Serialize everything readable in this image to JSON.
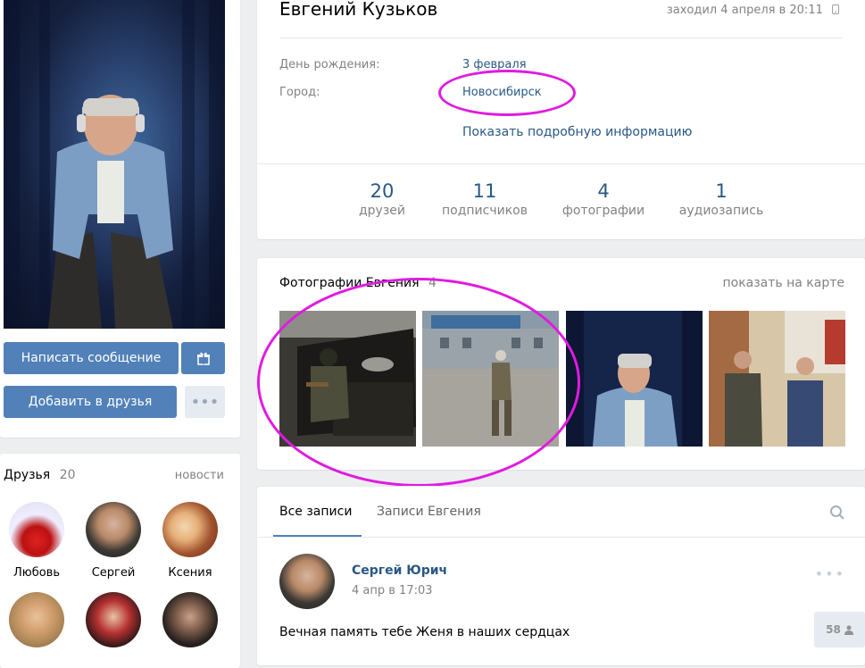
{
  "actions": {
    "send_message": "Написать сообщение",
    "add_friend": "Добавить в друзья",
    "more": "•••"
  },
  "friends": {
    "title": "Друзья",
    "count": "20",
    "news_link": "новости",
    "items": [
      {
        "name": "Любовь"
      },
      {
        "name": "Сергей"
      },
      {
        "name": "Ксения"
      },
      {
        "name": ""
      },
      {
        "name": ""
      },
      {
        "name": ""
      }
    ]
  },
  "profile": {
    "name": "Евгений Кузьков",
    "last_seen": "заходил 4 апреля в 20:11",
    "birthday_label": "День рождения:",
    "birthday_value": "3 февраля",
    "city_label": "Город:",
    "city_value": "Новосибирск",
    "more_info": "Показать подробную информацию"
  },
  "counters": [
    {
      "num": "20",
      "label": "друзей"
    },
    {
      "num": "11",
      "label": "подписчиков"
    },
    {
      "num": "4",
      "label": "фотографии"
    },
    {
      "num": "1",
      "label": "аудиозапись"
    }
  ],
  "photos": {
    "title": "Фотографии Евгения",
    "count": "4",
    "map_link": "показать на карте"
  },
  "wall": {
    "tab_all": "Все записи",
    "tab_own": "Записи Евгения",
    "post": {
      "author": "Сергей Юрич",
      "time": "4 апр в 17:03",
      "text": "Вечная память тебе Женя в наших сердцах",
      "views": "58"
    }
  },
  "colors": {
    "accent": "#5181b8",
    "link": "#2a5885",
    "highlight": "#e01be0",
    "background": "#edeef0"
  }
}
